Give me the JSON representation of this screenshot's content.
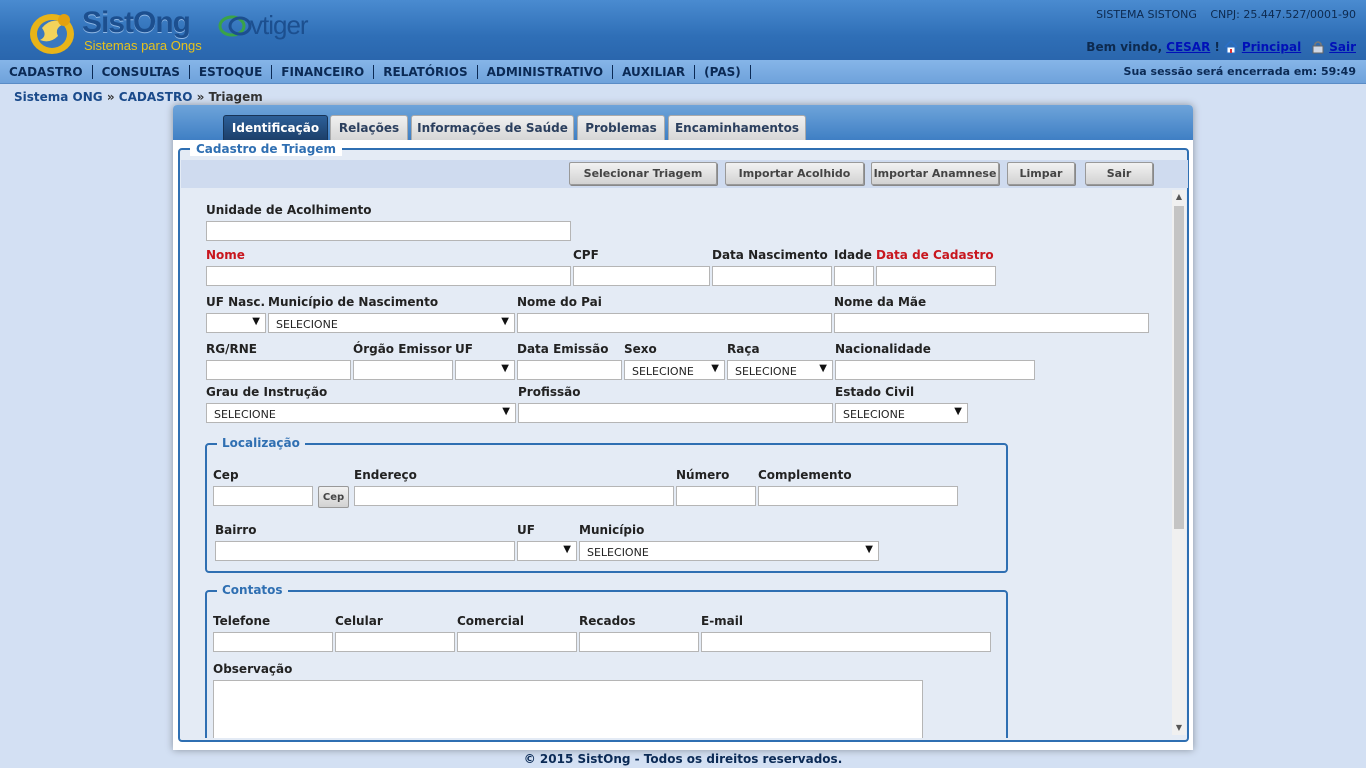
{
  "header": {
    "brand": "SistOng",
    "brand_sub": "Sistemas para Ongs",
    "partner": "vtiger",
    "system": "SISTEMA SISTONG",
    "cnpj": "CNPJ: 25.447.527/0001-90",
    "welcome_prefix": "Bem vindo,",
    "user": "CESAR",
    "excl": "!",
    "principal": "Principal",
    "exit": "Sair"
  },
  "nav": {
    "items": [
      "CADASTRO",
      "CONSULTAS",
      "ESTOQUE",
      "FINANCEIRO",
      "RELATÓRIOS",
      "ADMINISTRATIVO",
      "AUXILIAR",
      "(PAS)"
    ],
    "session": "Sua sessão será encerrada em: 59:49"
  },
  "breadcrumb": {
    "root": "Sistema ONG",
    "sep": "»",
    "section": "CADASTRO",
    "page": "Triagem"
  },
  "tabs": [
    "Identificação",
    "Relações",
    "Informações de Saúde",
    "Problemas",
    "Encaminhamentos"
  ],
  "form": {
    "legend": "Cadastro de Triagem",
    "buttons": [
      "Selecionar Triagem",
      "Importar Acolhido",
      "Importar Anamnese",
      "Limpar",
      "Sair"
    ],
    "labels": {
      "unidade": "Unidade de Acolhimento",
      "nome": "Nome",
      "cpf": "CPF",
      "data_nasc": "Data Nascimento",
      "idade": "Idade",
      "data_cadastro": "Data de Cadastro",
      "uf_nasc": "UF Nasc.",
      "municipio_nasc": "Município de Nascimento",
      "pai": "Nome do Pai",
      "mae": "Nome da Mãe",
      "rg": "RG/RNE",
      "orgao": "Órgão Emissor",
      "uf": "UF",
      "data_emissao": "Data Emissão",
      "sexo": "Sexo",
      "raca": "Raça",
      "nacionalidade": "Nacionalidade",
      "grau": "Grau de Instrução",
      "profissao": "Profissão",
      "estado_civil": "Estado Civil"
    },
    "select_default": "SELECIONE",
    "localizacao": {
      "legend": "Localização",
      "cep": "Cep",
      "cep_button": "Cep",
      "endereco": "Endereço",
      "numero": "Número",
      "complemento": "Complemento",
      "bairro": "Bairro",
      "uf": "UF",
      "municipio": "Município"
    },
    "contatos": {
      "legend": "Contatos",
      "telefone": "Telefone",
      "celular": "Celular",
      "comercial": "Comercial",
      "recados": "Recados",
      "email": "E-mail",
      "observacao": "Observação"
    }
  },
  "footer": "© 2015 SistOng - Todos os direitos reservados."
}
